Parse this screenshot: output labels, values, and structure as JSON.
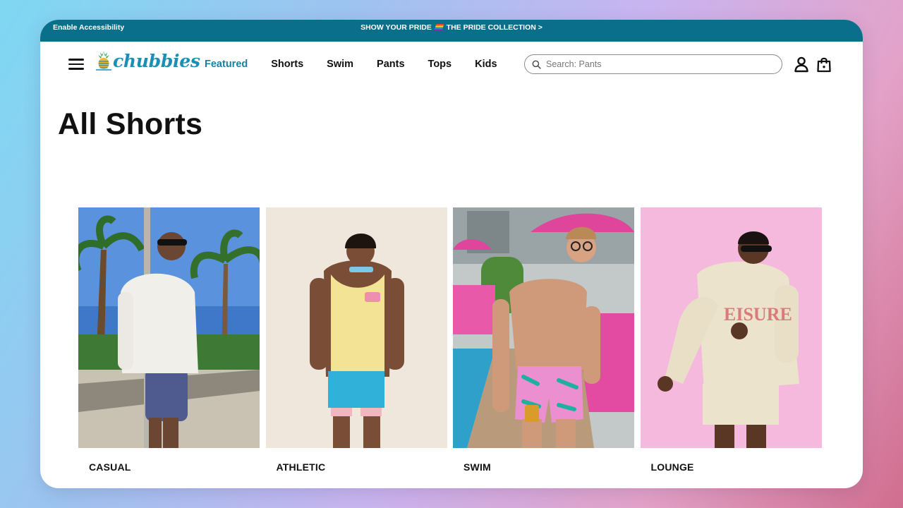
{
  "promo_bar": {
    "accessibility_label": "Enable Accessibility",
    "promo_text_before": "SHOW YOUR PRIDE",
    "promo_text_after": "THE PRIDE COLLECTION >",
    "background": "#0a6f8a"
  },
  "header": {
    "logo_text": "chubbies",
    "brand_color": "#1d8fb5",
    "nav": [
      {
        "label": "Featured",
        "active": true
      },
      {
        "label": "Shorts",
        "active": false
      },
      {
        "label": "Swim",
        "active": false
      },
      {
        "label": "Pants",
        "active": false
      },
      {
        "label": "Tops",
        "active": false
      },
      {
        "label": "Kids",
        "active": false
      }
    ],
    "search": {
      "placeholder": "Search: Pants",
      "value": "",
      "icon": "search-icon"
    },
    "icons": [
      "account-icon",
      "shopping-bag-icon"
    ]
  },
  "main": {
    "title": "All Shorts",
    "categories": [
      {
        "label": "CASUAL",
        "image": "man in white sweatshirt and navy shorts by palm trees"
      },
      {
        "label": "ATHLETIC",
        "image": "man in yellow tank top and blue athletic shorts"
      },
      {
        "label": "SWIM",
        "image": "shirtless man in pink alligator swim trunks at pool"
      },
      {
        "label": "LOUNGE",
        "image": "man in cream hoodie and shorts on pink background"
      }
    ]
  }
}
